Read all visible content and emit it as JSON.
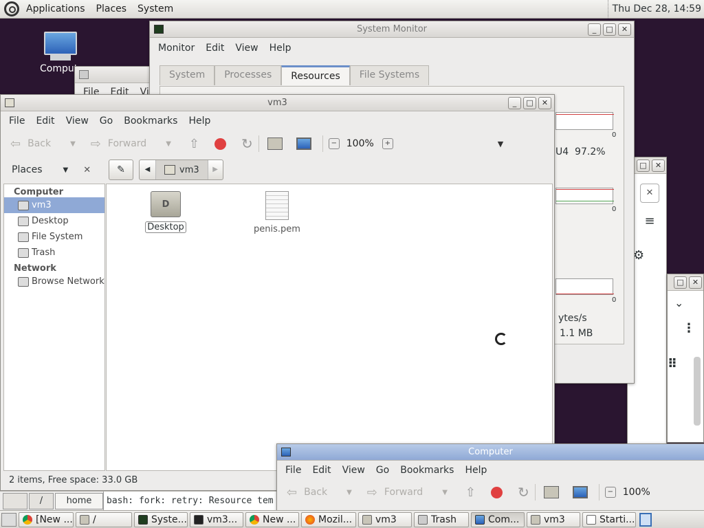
{
  "top_panel": {
    "menus": [
      "Applications",
      "Places",
      "System"
    ],
    "clock": "Thu Dec 28, 14:59"
  },
  "desktop": {
    "computer_icon_label": "Comput"
  },
  "sysmon": {
    "title": "System Monitor",
    "menus": [
      "Monitor",
      "Edit",
      "View",
      "Help"
    ],
    "tabs": [
      "System",
      "Processes",
      "Resources",
      "File Systems"
    ],
    "active_tab": "Resources",
    "cpu_label": "U4  97.2%",
    "axis_zero": "0",
    "net_rate": "ytes/s",
    "net_total": "1.1 MB"
  },
  "trash_win": {
    "menus": [
      "File",
      "Edit",
      "Vi"
    ]
  },
  "fm": {
    "title": "vm3",
    "menus": [
      "File",
      "Edit",
      "View",
      "Go",
      "Bookmarks",
      "Help"
    ],
    "back_label": "Back",
    "forward_label": "Forward",
    "zoom": "100%",
    "places_label": "Places",
    "path_current": "vm3",
    "sidebar": {
      "computer_header": "Computer",
      "computer_items": [
        "vm3",
        "Desktop",
        "File System",
        "Trash"
      ],
      "network_header": "Network",
      "network_items": [
        "Browse Network"
      ]
    },
    "files": [
      {
        "name": "Desktop",
        "type": "folder"
      },
      {
        "name": "penis.pem",
        "type": "file"
      }
    ],
    "status": "2 items, Free space: 33.0 GB"
  },
  "terminal": {
    "path_tabs": [
      "/",
      "home"
    ],
    "line": "bash: fork: retry: Resource tem"
  },
  "computer_win": {
    "title": "Computer",
    "menus": [
      "File",
      "Edit",
      "View",
      "Go",
      "Bookmarks",
      "Help"
    ],
    "back_label": "Back",
    "forward_label": "Forward",
    "zoom": "100%"
  },
  "taskbar": {
    "items": [
      "[New ...",
      "/",
      "Syste...",
      "vm3...",
      "New ...",
      "Mozil...",
      "vm3",
      "Trash",
      "Com...",
      "vm3",
      "Starti..."
    ]
  }
}
